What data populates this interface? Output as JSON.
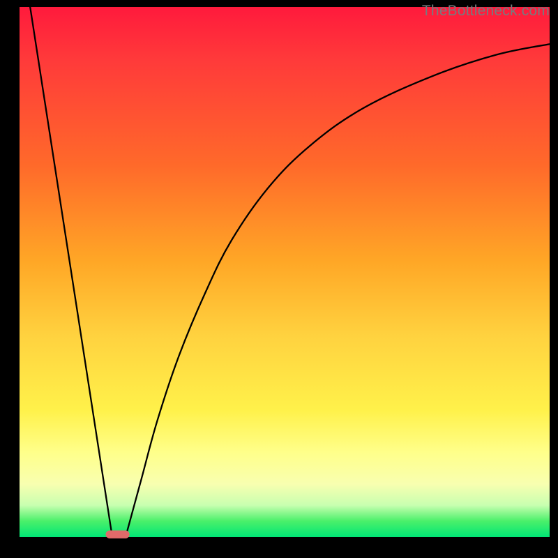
{
  "watermark": "TheBottleneck.com",
  "chart_data": {
    "type": "line",
    "title": "",
    "xlabel": "",
    "ylabel": "",
    "xlim": [
      0,
      100
    ],
    "ylim": [
      0,
      100
    ],
    "grid": false,
    "series": [
      {
        "name": "curve-left",
        "x": [
          2,
          17.5
        ],
        "y": [
          100,
          0
        ],
        "style": "line"
      },
      {
        "name": "curve-right",
        "x": [
          20,
          23,
          26,
          30,
          35,
          40,
          47,
          55,
          65,
          78,
          90,
          100
        ],
        "y": [
          0,
          11,
          22,
          34,
          46,
          56,
          66,
          74,
          81,
          87,
          91,
          93
        ],
        "style": "curve"
      }
    ],
    "marker": {
      "x": 18.5,
      "y": 0.5,
      "width": 4.5,
      "height": 1.5,
      "color": "#e26a6a"
    },
    "background_gradient": {
      "stops": [
        {
          "pos": 0,
          "color": "#ff1a3c"
        },
        {
          "pos": 30,
          "color": "#ff6a2a"
        },
        {
          "pos": 62,
          "color": "#ffd23f"
        },
        {
          "pos": 84,
          "color": "#ffff8a"
        },
        {
          "pos": 97,
          "color": "#4af06a"
        },
        {
          "pos": 100,
          "color": "#00e676"
        }
      ]
    }
  }
}
